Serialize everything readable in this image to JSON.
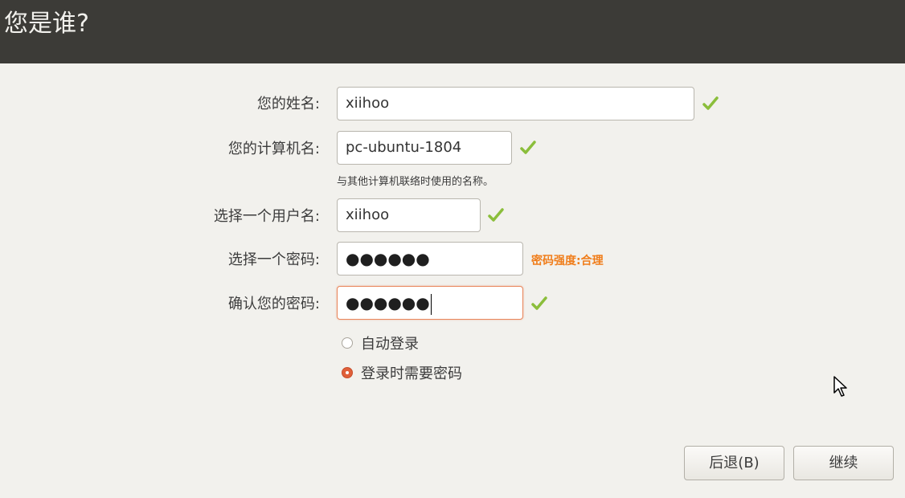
{
  "header": {
    "title": "您是谁?"
  },
  "form": {
    "name": {
      "label": "您的姓名:",
      "value": "xiihoo"
    },
    "computer": {
      "label": "您的计算机名:",
      "value": "pc-ubuntu-1804",
      "hint": "与其他计算机联络时使用的名称。"
    },
    "username": {
      "label": "选择一个用户名:",
      "value": "xiihoo"
    },
    "password": {
      "label": "选择一个密码:",
      "value": "●●●●●●",
      "strength": "密码强度:合理"
    },
    "confirm": {
      "label": "确认您的密码:",
      "value": "●●●●●●"
    }
  },
  "login_options": [
    {
      "label": "自动登录",
      "selected": false
    },
    {
      "label": "登录时需要密码",
      "selected": true
    }
  ],
  "buttons": {
    "back": "后退(B)",
    "continue": "继续"
  },
  "colors": {
    "header_bg": "#3c3b37",
    "page_bg": "#f2f1ed",
    "check_green": "#8bbe3b",
    "strength_orange": "#f07d1a",
    "radio_selected": "#e0603a",
    "focus_border": "#e9865b"
  },
  "icons": {
    "check": "checkmark-icon",
    "pointer": "mouse-pointer-icon"
  }
}
